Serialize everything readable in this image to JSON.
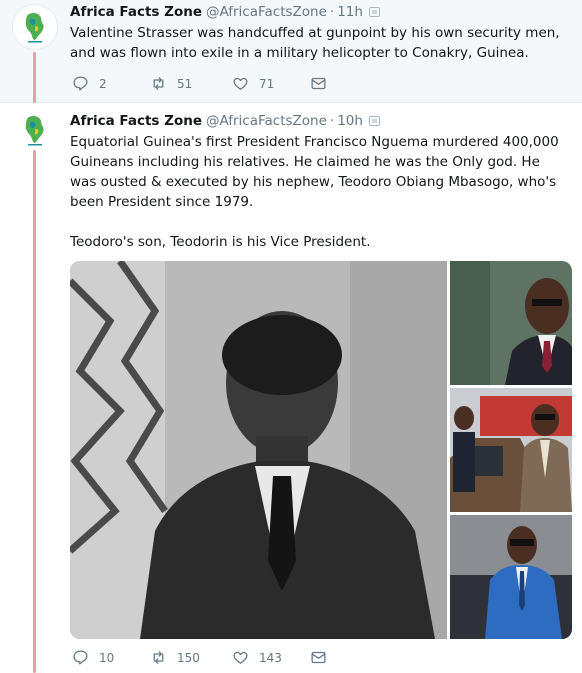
{
  "tweets": [
    {
      "author_name": "Africa Facts Zone",
      "handle": "@AfricaFactsZone",
      "time": "11h",
      "text": "Valentine Strasser was handcuffed at gunpoint by his own security men, and was flown into exile in a military helicopter to Conakry, Guinea.",
      "replies": "2",
      "retweets": "51",
      "likes": "71"
    },
    {
      "author_name": "Africa Facts Zone",
      "handle": "@AfricaFactsZone",
      "time": "10h",
      "text": "Equatorial Guinea's first President Francisco Nguema murdered 400,000 Guineans including his relatives. He claimed he was the Only god. He was ousted & executed by his nephew, Teodoro Obiang Mbasogo, who's been President since 1979.\n\nTeodoro's son, Teodorin is his Vice President.",
      "replies": "10",
      "retweets": "150",
      "likes": "143"
    }
  ],
  "colors": {
    "thread_line": "#e6a0a8",
    "muted_text": "#657786",
    "logo_green": "#4caf50",
    "logo_teal": "#1a8fa0"
  },
  "icons": {
    "reply": "reply-icon",
    "retweet": "retweet-icon",
    "like": "heart-icon",
    "message": "envelope-icon",
    "caret": "caret-down-icon"
  }
}
